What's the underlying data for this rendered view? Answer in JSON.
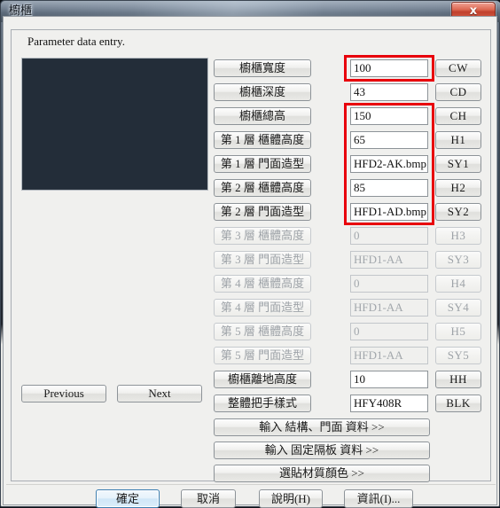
{
  "window": {
    "title": "櫥櫃",
    "close_label": "x",
    "close_icon": "close-icon"
  },
  "group": {
    "legend": "Parameter data entry."
  },
  "preview": {
    "name": "cabinet-preview",
    "background": "#232d39"
  },
  "colors": {
    "highlight": "#e8000c",
    "dialog_bg": "#f0f0ee",
    "field_bg": "#ffffff",
    "disabled_text": "#a2a7ac",
    "focus_border": "#3c7fb1"
  },
  "rows": [
    {
      "label": "櫥櫃寬度",
      "value": "100",
      "tag": "CW",
      "enabled": true,
      "highlight": "single"
    },
    {
      "label": "櫥櫃深度",
      "value": "43",
      "tag": "CD",
      "enabled": true,
      "highlight": "none"
    },
    {
      "label": "櫥櫃總高",
      "value": "150",
      "tag": "CH",
      "enabled": true,
      "highlight": "group"
    },
    {
      "label": "第 1 層 櫃體高度",
      "value": "65",
      "tag": "H1",
      "enabled": true,
      "highlight": "group"
    },
    {
      "label": "第 1 層 門面造型",
      "value": "HFD2-AK.bmp",
      "tag": "SY1",
      "enabled": true,
      "highlight": "group"
    },
    {
      "label": "第 2 層 櫃體高度",
      "value": "85",
      "tag": "H2",
      "enabled": true,
      "highlight": "group"
    },
    {
      "label": "第 2 層 門面造型",
      "value": "HFD1-AD.bmp",
      "tag": "SY2",
      "enabled": true,
      "highlight": "group"
    },
    {
      "label": "第 3 層 櫃體高度",
      "value": "0",
      "tag": "H3",
      "enabled": false,
      "highlight": "none"
    },
    {
      "label": "第 3 層 門面造型",
      "value": "HFD1-AA",
      "tag": "SY3",
      "enabled": false,
      "highlight": "none"
    },
    {
      "label": "第 4 層 櫃體高度",
      "value": "0",
      "tag": "H4",
      "enabled": false,
      "highlight": "none"
    },
    {
      "label": "第 4 層 門面造型",
      "value": "HFD1-AA",
      "tag": "SY4",
      "enabled": false,
      "highlight": "none"
    },
    {
      "label": "第 5 層 櫃體高度",
      "value": "0",
      "tag": "H5",
      "enabled": false,
      "highlight": "none"
    },
    {
      "label": "第 5 層 門面造型",
      "value": "HFD1-AA",
      "tag": "SY5",
      "enabled": false,
      "highlight": "none"
    },
    {
      "label": "櫥櫃離地高度",
      "value": "10",
      "tag": "HH",
      "enabled": true,
      "highlight": "none"
    },
    {
      "label": "整體把手樣式",
      "value": "HFY408R",
      "tag": "BLK",
      "enabled": true,
      "highlight": "none"
    }
  ],
  "nav": {
    "previous": "Previous",
    "next": "Next"
  },
  "wide_buttons": [
    {
      "label": "輸入 結構、門面 資料 >>",
      "name": "input-structure-door-data-button"
    },
    {
      "label": "輸入 固定隔板 資料 >>",
      "name": "input-fixed-shelf-data-button"
    },
    {
      "label": "選貼材質顏色 >>",
      "name": "select-material-color-button"
    }
  ],
  "footer": {
    "ok": "確定",
    "cancel": "取消",
    "help": "說明(H)",
    "info": "資訊(I)..."
  }
}
